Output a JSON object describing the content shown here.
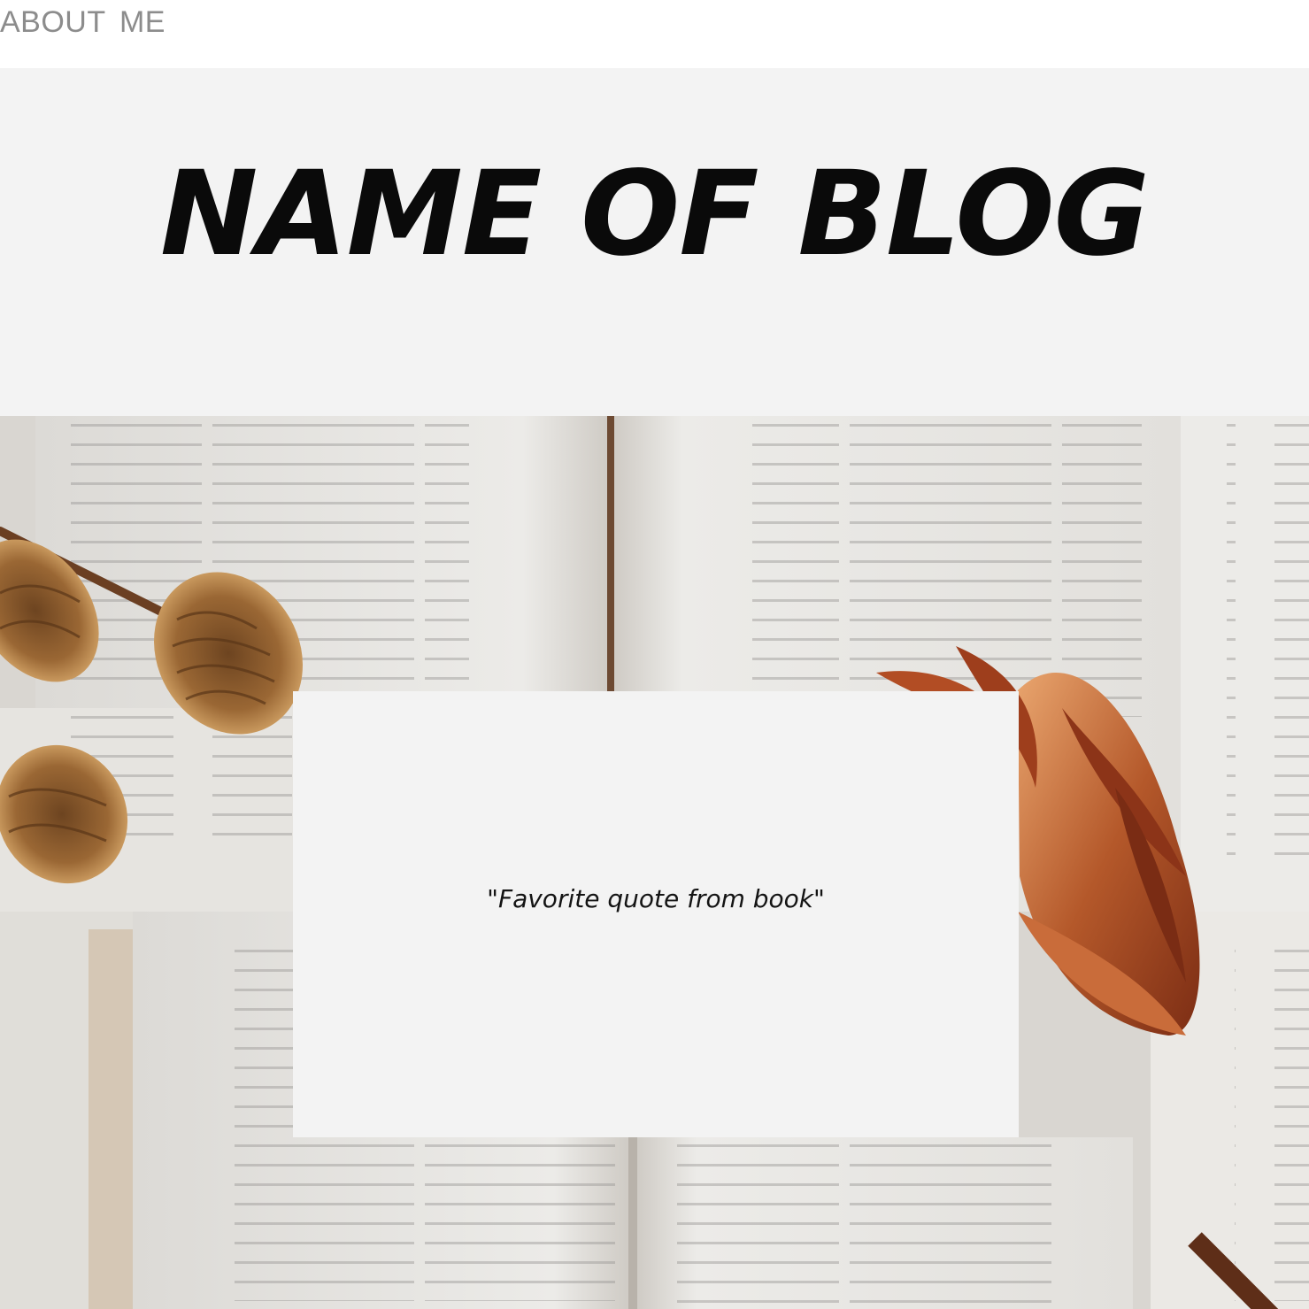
{
  "nav": {
    "about_label": "ABOUT ME"
  },
  "header": {
    "title": "NAME OF BLOG"
  },
  "quote_card": {
    "text": "\"Favorite quote from book\""
  },
  "colors": {
    "nav_text": "#8c8c8c",
    "header_bg": "#f3f3f3",
    "title_text": "#0a0a0a",
    "card_bg": "#f3f3f3",
    "page_paper": "#ebeae7",
    "pine_cone": "#8a5a2b",
    "protea_flower": "#a44e22"
  },
  "icons": {
    "hero_image": "open-books-with-pine-cones-and-dried-protea-photo"
  }
}
